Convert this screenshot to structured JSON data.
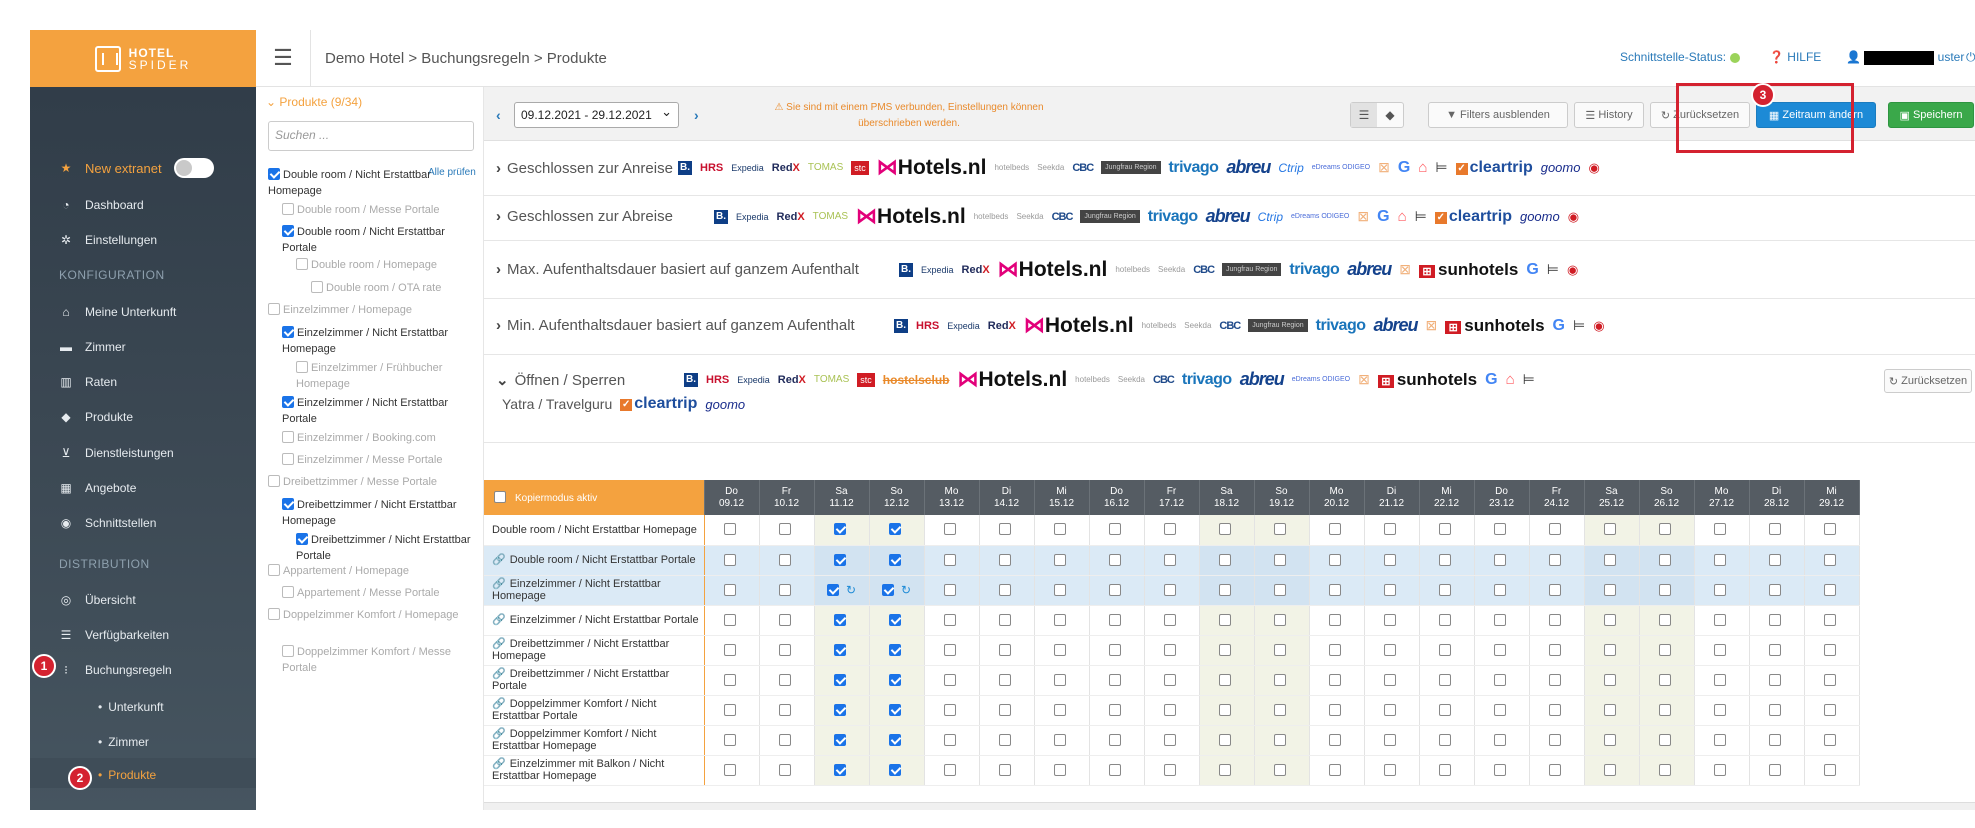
{
  "sidebar": {
    "logo_line1": "HOTEL",
    "logo_line2": "SPIDER",
    "new_extranet": "New extranet",
    "items": [
      "Dashboard",
      "Einstellungen"
    ],
    "section_config": "KONFIGURATION",
    "config_items": [
      "Meine Unterkunft",
      "Zimmer",
      "Raten",
      "Produkte",
      "Dienstleistungen",
      "Angebote",
      "Schnittstellen"
    ],
    "section_dist": "DISTRIBUTION",
    "dist_items": [
      "Übersicht",
      "Verfügbarkeiten",
      "Buchungsregeln"
    ],
    "sub_items": [
      "Unterkunft",
      "Zimmer",
      "Produkte"
    ]
  },
  "header": {
    "breadcrumb": "Demo Hotel  >  Buchungsregeln > Produkte",
    "status_label": "Schnittstelle-Status:",
    "help": "HILFE",
    "user": "uster"
  },
  "badges": [
    "1",
    "2",
    "3"
  ],
  "products": {
    "header": "Produkte (9/34)",
    "search_placeholder": "Suchen ...",
    "check_all": "Alle prüfen",
    "items": [
      {
        "label": "Double room / Nicht Erstattbar Homepage",
        "checked": true,
        "disabled": false
      },
      {
        "label": "Double room / Messe Portale",
        "checked": false,
        "disabled": true
      },
      {
        "label": "Double room / Nicht Erstattbar Portale",
        "checked": true,
        "disabled": false
      },
      {
        "label": "Double room / Homepage",
        "checked": false,
        "disabled": true
      },
      {
        "label": "Double room / OTA rate",
        "checked": false,
        "disabled": true
      },
      {
        "label": "Einzelzimmer / Homepage",
        "checked": false,
        "disabled": true
      },
      {
        "label": "Einzelzimmer / Nicht Erstattbar Homepage",
        "checked": true,
        "disabled": false
      },
      {
        "label": "Einzelzimmer / Frühbucher Homepage",
        "checked": false,
        "disabled": true
      },
      {
        "label": "Einzelzimmer / Nicht Erstattbar Portale",
        "checked": true,
        "disabled": false
      },
      {
        "label": "Einzelzimmer / Booking.com",
        "checked": false,
        "disabled": true
      },
      {
        "label": "Einzelzimmer / Messe Portale",
        "checked": false,
        "disabled": true
      },
      {
        "label": "Dreibettzimmer / Messe Portale",
        "checked": false,
        "disabled": true
      },
      {
        "label": "Dreibettzimmer / Nicht Erstattbar Homepage",
        "checked": true,
        "disabled": false
      },
      {
        "label": "Dreibettzimmer / Nicht Erstattbar Portale",
        "checked": true,
        "disabled": false
      },
      {
        "label": "Appartement / Homepage",
        "checked": false,
        "disabled": true
      },
      {
        "label": "Appartement / Messe Portale",
        "checked": false,
        "disabled": true
      },
      {
        "label": "Doppelzimmer Komfort / Homepage",
        "checked": false,
        "disabled": true
      },
      {
        "label": "Doppelzimmer Komfort / Messe Portale",
        "checked": false,
        "disabled": true
      }
    ]
  },
  "toolbar": {
    "date_range": "09.12.2021 - 29.12.2021",
    "warning": "⚠ Sie sind mit einem PMS verbunden, Einstellungen können überschrieben werden.",
    "filters": "Filters ausblenden",
    "history": "History",
    "reset": "Zurücksetzen",
    "change_period": "Zeitraum ändern",
    "save": "Speichern"
  },
  "rules": [
    "Geschlossen zur Anreise",
    "Geschlossen zur Abreise",
    "Max. Aufenthaltsdauer basiert auf ganzem Aufenthalt",
    "Min. Aufenthaltsdauer basiert auf ganzem Aufenthalt",
    "Öffnen / Sperren"
  ],
  "rule_reset": "Zurücksetzen",
  "yatra_alt": "Yatra / Travelguru",
  "logos": {
    "hrs": "HRS",
    "expedia": "Expedia",
    "redx": "Red",
    "tomas": "TOMAS",
    "stc": "stc",
    "hotelsnl": "Hotels.nl",
    "ctrip": "Ctrip",
    "cbc": "CBC",
    "jungfrau": "Jungfrau Region",
    "trivago": "trivago",
    "abreu": "abreu",
    "edreams": "eDreams ODIGEO",
    "google": "G",
    "cleartrip": "cleartrip",
    "goibibo": "goomo",
    "sunhotels": "sunhotels",
    "hostelsclub": "hostelsclub",
    "hotelbeds": "hotelbeds",
    "seekda": "Seekda"
  },
  "grid": {
    "copy_mode": "Kopiermodus aktiv",
    "days": [
      {
        "wd": "Do",
        "d": "09.12"
      },
      {
        "wd": "Fr",
        "d": "10.12"
      },
      {
        "wd": "Sa",
        "d": "11.12"
      },
      {
        "wd": "So",
        "d": "12.12"
      },
      {
        "wd": "Mo",
        "d": "13.12"
      },
      {
        "wd": "Di",
        "d": "14.12"
      },
      {
        "wd": "Mi",
        "d": "15.12"
      },
      {
        "wd": "Do",
        "d": "16.12"
      },
      {
        "wd": "Fr",
        "d": "17.12"
      },
      {
        "wd": "Sa",
        "d": "18.12"
      },
      {
        "wd": "So",
        "d": "19.12"
      },
      {
        "wd": "Mo",
        "d": "20.12"
      },
      {
        "wd": "Di",
        "d": "21.12"
      },
      {
        "wd": "Mi",
        "d": "22.12"
      },
      {
        "wd": "Do",
        "d": "23.12"
      },
      {
        "wd": "Fr",
        "d": "24.12"
      },
      {
        "wd": "Sa",
        "d": "25.12"
      },
      {
        "wd": "So",
        "d": "26.12"
      },
      {
        "wd": "Mo",
        "d": "27.12"
      },
      {
        "wd": "Di",
        "d": "28.12"
      },
      {
        "wd": "Mi",
        "d": "29.12"
      }
    ],
    "rows": [
      {
        "label": "Double room / Nicht Erstattbar Homepage",
        "linked": false,
        "highlight": false,
        "sync": false
      },
      {
        "label": "Double room / Nicht Erstattbar Portale",
        "linked": true,
        "highlight": true,
        "sync": false
      },
      {
        "label": "Einzelzimmer / Nicht Erstattbar Homepage",
        "linked": true,
        "highlight": true,
        "sync": true
      },
      {
        "label": "Einzelzimmer / Nicht Erstattbar Portale",
        "linked": true,
        "highlight": false,
        "sync": false
      },
      {
        "label": "Dreibettzimmer / Nicht Erstattbar Homepage",
        "linked": true,
        "highlight": false,
        "sync": false
      },
      {
        "label": "Dreibettzimmer / Nicht Erstattbar Portale",
        "linked": true,
        "highlight": false,
        "sync": false
      },
      {
        "label": "Doppelzimmer Komfort / Nicht Erstattbar Portale",
        "linked": true,
        "highlight": false,
        "sync": false
      },
      {
        "label": "Doppelzimmer Komfort / Nicht Erstattbar Homepage",
        "linked": true,
        "highlight": false,
        "sync": false
      },
      {
        "label": "Einzelzimmer mit Balkon / Nicht Erstattbar Homepage",
        "linked": true,
        "highlight": false,
        "sync": false
      }
    ],
    "checked_columns": [
      2,
      3
    ]
  }
}
